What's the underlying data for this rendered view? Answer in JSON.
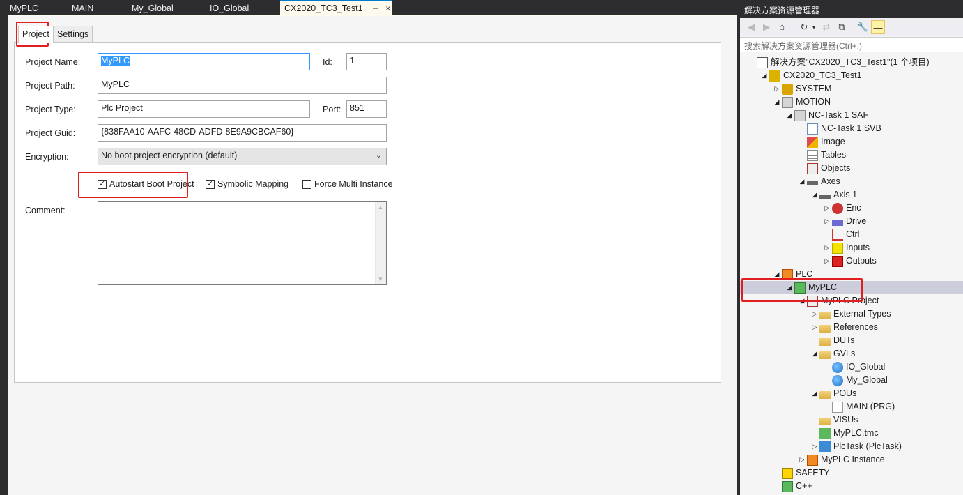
{
  "editor": {
    "tabs": [
      {
        "label": "MyPLC"
      },
      {
        "label": "MAIN"
      },
      {
        "label": "My_Global"
      },
      {
        "label": "IO_Global"
      },
      {
        "label": "CX2020_TC3_Test1",
        "pin": "⊣",
        "close": "×"
      }
    ],
    "property_tabs": [
      "Project",
      "Settings"
    ],
    "form": {
      "project_name_label": "Project Name:",
      "project_name_value": "MyPLC",
      "id_label": "Id:",
      "id_value": "1",
      "project_path_label": "Project Path:",
      "project_path_value": "MyPLC",
      "project_type_label": "Project Type:",
      "project_type_value": "Plc Project",
      "port_label": "Port:",
      "port_value": "851",
      "project_guid_label": "Project Guid:",
      "project_guid_value": "{838FAA10-AAFC-48CD-ADFD-8E9A9CBCAF60}",
      "encryption_label": "Encryption:",
      "encryption_value": "No boot project encryption (default)",
      "checkboxes": [
        {
          "label": "Autostart Boot Project",
          "checked": true
        },
        {
          "label": "Symbolic Mapping",
          "checked": true
        },
        {
          "label": "Force Multi Instance",
          "checked": false
        }
      ],
      "comment_label": "Comment:",
      "comment_value": ""
    }
  },
  "explorer": {
    "title": "解决方案资源管理器",
    "search_placeholder": "搜索解决方案资源管理器(Ctrl+;)",
    "toolbar": [
      "back-icon",
      "forward-icon",
      "home-icon",
      "history-icon",
      "sync-icon",
      "collapse-all-icon",
      "properties-icon",
      "pin-icon"
    ],
    "tree": [
      {
        "label": "解决方案\"CX2020_TC3_Test1\"(1 个项目)",
        "icon": "solution-icon",
        "cls": "ic-sol",
        "level": 0,
        "tw": ""
      },
      {
        "label": "CX2020_TC3_Test1",
        "icon": "project-icon",
        "cls": "ic-proj",
        "level": 1,
        "tw": "◢"
      },
      {
        "label": "SYSTEM",
        "icon": "system-icon",
        "cls": "ic-gear",
        "level": 2,
        "tw": "▷"
      },
      {
        "label": "MOTION",
        "icon": "motion-icon",
        "cls": "ic-motion",
        "level": 2,
        "tw": "◢"
      },
      {
        "label": "NC-Task 1 SAF",
        "icon": "nc-task-icon",
        "cls": "ic-motion",
        "level": 3,
        "tw": "◢"
      },
      {
        "label": "NC-Task 1 SVB",
        "icon": "document-icon",
        "cls": "ic-doc",
        "level": 4,
        "tw": ""
      },
      {
        "label": "Image",
        "icon": "image-icon",
        "cls": "ic-img",
        "level": 4,
        "tw": ""
      },
      {
        "label": "Tables",
        "icon": "table-icon",
        "cls": "ic-table",
        "level": 4,
        "tw": ""
      },
      {
        "label": "Objects",
        "icon": "objects-icon",
        "cls": "ic-obj",
        "level": 4,
        "tw": ""
      },
      {
        "label": "Axes",
        "icon": "axes-icon",
        "cls": "ic-axes",
        "level": 4,
        "tw": "◢"
      },
      {
        "label": "Axis 1",
        "icon": "axis-icon",
        "cls": "ic-axes",
        "level": 5,
        "tw": "◢"
      },
      {
        "label": "Enc",
        "icon": "encoder-icon",
        "cls": "ic-enc",
        "level": 6,
        "tw": "▷"
      },
      {
        "label": "Drive",
        "icon": "drive-icon",
        "cls": "ic-drive",
        "level": 6,
        "tw": "▷"
      },
      {
        "label": "Ctrl",
        "icon": "ctrl-icon",
        "cls": "ic-ctrl",
        "level": 6,
        "tw": ""
      },
      {
        "label": "Inputs",
        "icon": "inputs-icon",
        "cls": "ic-in",
        "level": 6,
        "tw": "▷"
      },
      {
        "label": "Outputs",
        "icon": "outputs-icon",
        "cls": "ic-out",
        "level": 6,
        "tw": "▷"
      },
      {
        "label": "PLC",
        "icon": "plc-icon",
        "cls": "ic-plc",
        "level": 2,
        "tw": "◢"
      },
      {
        "label": "MyPLC",
        "icon": "plc-project-icon",
        "cls": "ic-plcproj",
        "level": 3,
        "tw": "◢",
        "selected": true
      },
      {
        "label": "MyPLC Project",
        "icon": "plc-code-icon",
        "cls": "ic-obj",
        "level": 4,
        "tw": "◢"
      },
      {
        "label": "External Types",
        "icon": "folder-icon",
        "cls": "ic-folder",
        "level": 5,
        "tw": "▷"
      },
      {
        "label": "References",
        "icon": "references-icon",
        "cls": "ic-folder",
        "level": 5,
        "tw": "▷"
      },
      {
        "label": "DUTs",
        "icon": "folder-icon",
        "cls": "ic-folder",
        "level": 5,
        "tw": ""
      },
      {
        "label": "GVLs",
        "icon": "folder-open-icon",
        "cls": "ic-folder",
        "level": 5,
        "tw": "◢"
      },
      {
        "label": "IO_Global",
        "icon": "globe-icon",
        "cls": "ic-globe",
        "level": 6,
        "tw": ""
      },
      {
        "label": "My_Global",
        "icon": "globe-icon",
        "cls": "ic-globe",
        "level": 6,
        "tw": ""
      },
      {
        "label": "POUs",
        "icon": "folder-open-icon",
        "cls": "ic-folder",
        "level": 5,
        "tw": "◢"
      },
      {
        "label": "MAIN (PRG)",
        "icon": "pou-icon",
        "cls": "ic-pou",
        "level": 6,
        "tw": ""
      },
      {
        "label": "VISUs",
        "icon": "folder-icon",
        "cls": "ic-folder",
        "level": 5,
        "tw": ""
      },
      {
        "label": "MyPLC.tmc",
        "icon": "tmc-icon",
        "cls": "ic-tmc",
        "level": 5,
        "tw": ""
      },
      {
        "label": "PlcTask (PlcTask)",
        "icon": "task-icon",
        "cls": "ic-task",
        "level": 5,
        "tw": "▷"
      },
      {
        "label": "MyPLC Instance",
        "icon": "plc-instance-icon",
        "cls": "ic-plc",
        "level": 4,
        "tw": "▷"
      },
      {
        "label": "SAFETY",
        "icon": "safety-icon",
        "cls": "ic-safety",
        "level": 2,
        "tw": ""
      },
      {
        "label": "C++",
        "icon": "cpp-icon",
        "cls": "ic-cpp",
        "level": 2,
        "tw": ""
      }
    ]
  },
  "colors": {
    "accent": "#007acc",
    "highlight": "#e02020",
    "selection": "#cccedb"
  }
}
